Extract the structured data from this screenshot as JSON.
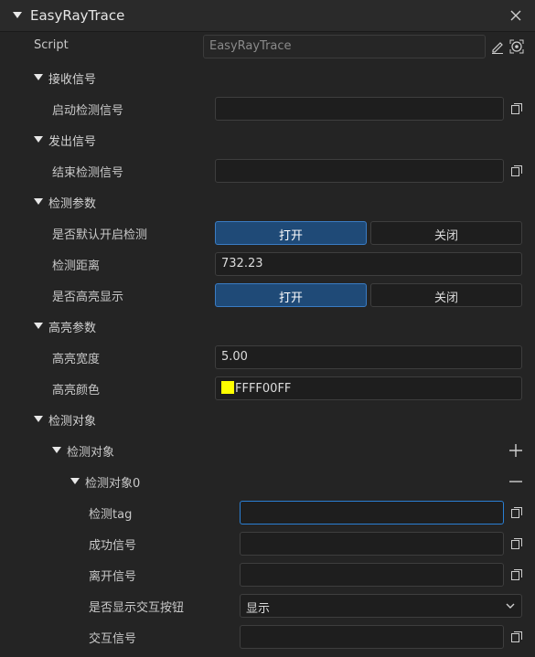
{
  "header": {
    "title": "EasyRayTrace"
  },
  "script": {
    "label": "Script",
    "value": "EasyRayTrace"
  },
  "receive": {
    "section": "接收信号",
    "start_signal": {
      "label": "启动检测信号",
      "value": ""
    }
  },
  "emit": {
    "section": "发出信号",
    "end_signal": {
      "label": "结束检测信号",
      "value": ""
    }
  },
  "detect": {
    "section": "检测参数",
    "default_on": {
      "label": "是否默认开启检测",
      "on": "打开",
      "off": "关闭"
    },
    "distance": {
      "label": "检测距离",
      "value": "732.23"
    },
    "highlight_show": {
      "label": "是否高亮显示",
      "on": "打开",
      "off": "关闭"
    }
  },
  "highlight": {
    "section": "高亮参数",
    "width": {
      "label": "高亮宽度",
      "value": "5.00"
    },
    "color": {
      "label": "高亮颜色",
      "value": "FFFF00FF",
      "swatch": "#ffff00"
    }
  },
  "targets": {
    "section": "检测对象",
    "array_label": "检测对象",
    "item": {
      "label": "检测对象0",
      "tag": {
        "label": "检测tag",
        "value": ""
      },
      "success": {
        "label": "成功信号",
        "value": ""
      },
      "leave": {
        "label": "离开信号",
        "value": ""
      },
      "show_button": {
        "label": "是否显示交互按钮",
        "value": "显示"
      },
      "interact": {
        "label": "交互信号",
        "value": ""
      }
    }
  },
  "colors": {
    "accent": "#2a7fd4",
    "toggle_on": "#1f4a77",
    "background": "#242424"
  },
  "icons": [
    "caret-down-icon",
    "close-icon",
    "edit-icon",
    "locate-icon",
    "copy-icon",
    "plus-icon",
    "minus-icon",
    "chevron-down-icon"
  ]
}
